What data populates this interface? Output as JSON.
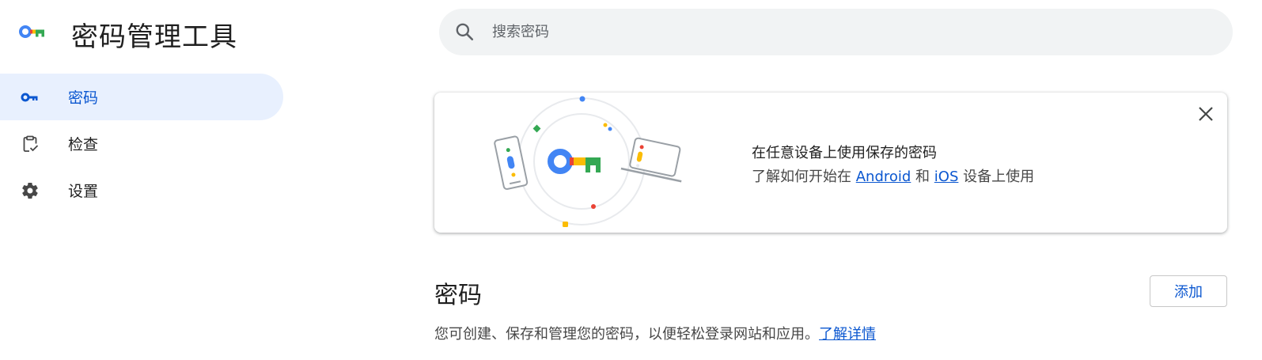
{
  "app": {
    "title": "密码管理工具",
    "logo_icon": "key-logo-icon"
  },
  "search": {
    "placeholder": "搜索密码",
    "icon": "search-icon"
  },
  "sidebar": {
    "items": [
      {
        "label": "密码",
        "icon": "key-icon",
        "active": true
      },
      {
        "label": "检查",
        "icon": "checkup-clipboard-icon",
        "active": false
      },
      {
        "label": "设置",
        "icon": "gear-icon",
        "active": false
      }
    ]
  },
  "promo": {
    "title": "在任意设备上使用保存的密码",
    "text_prefix": "了解如何开始在 ",
    "link_android": "Android",
    "text_and": " 和 ",
    "link_ios": "iOS",
    "text_suffix": " 设备上使用",
    "close_icon": "close-icon"
  },
  "passwords_section": {
    "title": "密码",
    "add_label": "添加",
    "description": "您可创建、保存和管理您的密码，以便轻松登录网站和应用。",
    "learn_more": "了解详情"
  },
  "colors": {
    "accent_blue": "#0b57d0",
    "active_nav_bg": "#e8f0fe",
    "google_blue": "#4285f4",
    "google_red": "#ea4335",
    "google_yellow": "#fbbc04",
    "google_green": "#34a853"
  }
}
